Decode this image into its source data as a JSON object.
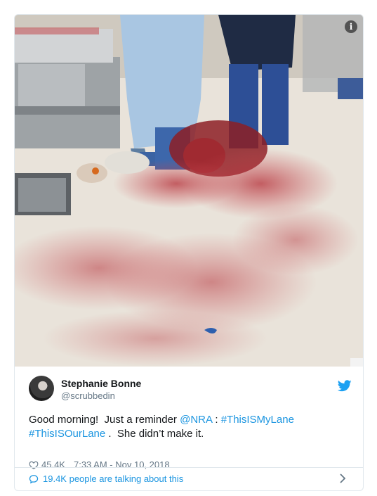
{
  "tweet": {
    "author_name": "Stephanie Bonne",
    "author_handle": "@scrubbedin",
    "text_1": "Good morning!  Just a reminder ",
    "mention": "@NRA",
    "text_2": " : ",
    "hashtag_1": "#ThisISMyLane",
    "hashtag_2": "#ThisISOurLane",
    "text_3": " .  She didn’t make it.",
    "likes": "45.4K",
    "timestamp": "7:33 AM - Nov 10, 2018",
    "talking": "19.4K people are talking about this"
  },
  "icons": {
    "info": "info-icon",
    "bird": "twitter-bird-icon",
    "heart": "heart-icon",
    "bubble": "reply-bubble-icon",
    "chevron": "chevron-right-icon"
  },
  "colors": {
    "link": "#1b95e0",
    "text": "#14171a",
    "muted": "#657786",
    "border": "#e1e8ed"
  },
  "media": {
    "info_glyph": "i"
  }
}
